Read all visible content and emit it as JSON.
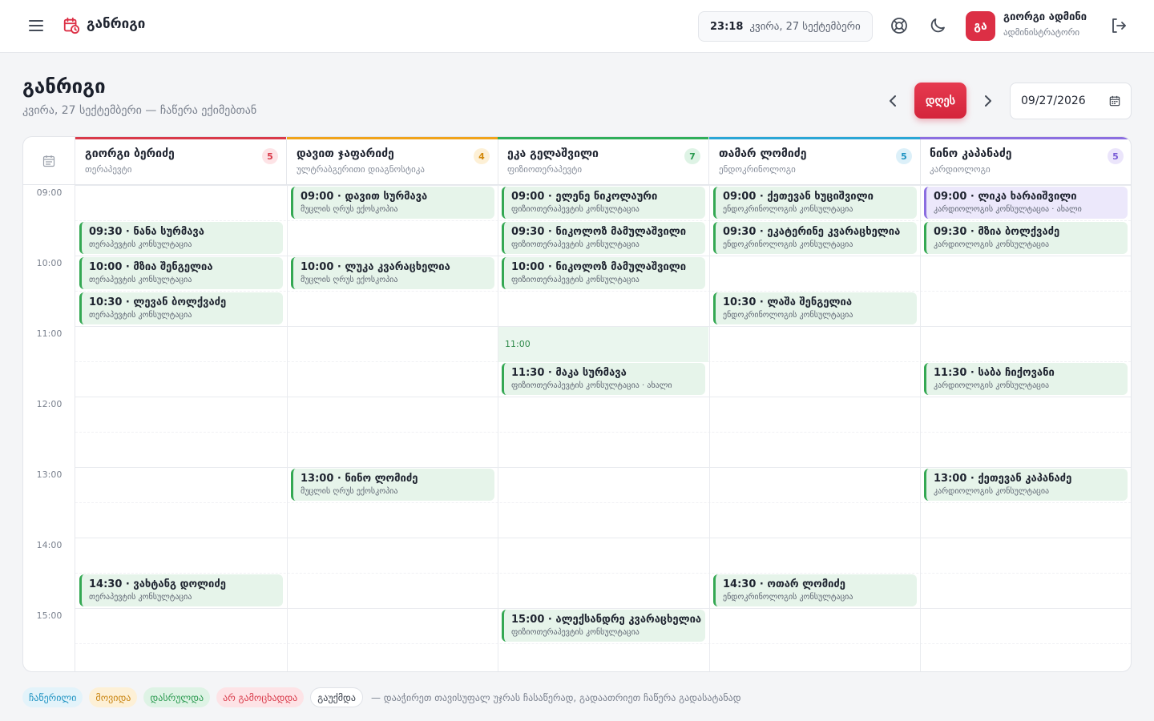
{
  "app": {
    "title": "განრიგი"
  },
  "topbar": {
    "time": "23:18",
    "date": "კვირა, 27 სექტემბერი",
    "user": {
      "initials": "გა",
      "name": "გიორგი ადმინი",
      "role": "ადმინისტრატორი"
    }
  },
  "page": {
    "title": "განრიგი",
    "subtitle": "კვირა, 27 სექტემბერი — ჩაწერა ექიმებთან",
    "day_button": "დღეს",
    "date_value": "09/27/2026"
  },
  "time_labels": [
    "09:00",
    "10:00",
    "11:00",
    "12:00",
    "13:00",
    "14:00",
    "15:00"
  ],
  "now_label": "11:00",
  "doctors": [
    {
      "name": "გიორგი ბერიძე",
      "role": "თერაპევტი",
      "count": "5",
      "color": "#d93a4a",
      "badge_bg": "#fde3e6",
      "badge_fg": "#d93a4a"
    },
    {
      "name": "დავით ჯაფარიძე",
      "role": "ულტრაბგერითი დიაგნოსტიკა",
      "count": "4",
      "color": "#f0a31b",
      "badge_bg": "#fdf0d6",
      "badge_fg": "#d38a0d"
    },
    {
      "name": "ეკა გელაშვილი",
      "role": "ფიზიოთერაპევტი",
      "count": "7",
      "color": "#2fae5a",
      "badge_bg": "#def3e5",
      "badge_fg": "#2b9a50"
    },
    {
      "name": "თამარ ლომიძე",
      "role": "ენდოკრინოლოგი",
      "count": "5",
      "color": "#2aa6d6",
      "badge_bg": "#dcf0f9",
      "badge_fg": "#1f93c2"
    },
    {
      "name": "ნინო კაპანაძე",
      "role": "კარდიოლოგი",
      "count": "5",
      "color": "#8b6ee0",
      "badge_bg": "#ebe5fb",
      "badge_fg": "#7a5cd6"
    }
  ],
  "appointments": [
    {
      "col": 0,
      "slot": 1,
      "title": "09:30 · ნანა სურმავა",
      "sub": "თერაპევტის კონსულტაცია",
      "kind": "done"
    },
    {
      "col": 0,
      "slot": 2,
      "title": "10:00 · მზია შენგელია",
      "sub": "თერაპევტის კონსულტაცია",
      "kind": "done"
    },
    {
      "col": 0,
      "slot": 3,
      "title": "10:30 · ლევან ბოლქვაძე",
      "sub": "თერაპევტის კონსულტაცია",
      "kind": "done"
    },
    {
      "col": 0,
      "slot": 11,
      "title": "14:30 · ვახტანგ დოლიძე",
      "sub": "თერაპევტის კონსულტაცია",
      "kind": "done"
    },
    {
      "col": 1,
      "slot": 0,
      "title": "09:00 · დავით სურმავა",
      "sub": "მუცლის ღრუს ექოსკოპია",
      "kind": "done"
    },
    {
      "col": 1,
      "slot": 2,
      "title": "10:00 · ლუკა კვარაცხელია",
      "sub": "მუცლის ღრუს ექოსკოპია",
      "kind": "done"
    },
    {
      "col": 1,
      "slot": 8,
      "title": "13:00 · ნინო ლომიძე",
      "sub": "მუცლის ღრუს ექოსკოპია",
      "kind": "done"
    },
    {
      "col": 2,
      "slot": 0,
      "title": "09:00 · ელენე ნიკოლაური",
      "sub": "ფიზიოთერაპევტის კონსულტაცია",
      "kind": "done"
    },
    {
      "col": 2,
      "slot": 1,
      "title": "09:30 · ნიკოლოზ მამულაშვილი",
      "sub": "ფიზიოთერაპევტის კონსულტაცია",
      "kind": "done"
    },
    {
      "col": 2,
      "slot": 2,
      "title": "10:00 · ნიკოლოზ მამულაშვილი",
      "sub": "ფიზიოთერაპევტის კონსულტაცია",
      "kind": "done"
    },
    {
      "col": 2,
      "slot": 5,
      "title": "11:30 · მაკა სურმავა",
      "sub": "ფიზიოთერაპევტის კონსულტაცია · ახალი",
      "kind": "done"
    },
    {
      "col": 2,
      "slot": 12,
      "title": "15:00 · ალექსანდრე კვარაცხელია",
      "sub": "ფიზიოთერაპევტის კონსულტაცია",
      "kind": "done"
    },
    {
      "col": 3,
      "slot": 0,
      "title": "09:00 · ქეთევან ხუციშვილი",
      "sub": "ენდოკრინოლოგის კონსულტაცია",
      "kind": "done"
    },
    {
      "col": 3,
      "slot": 1,
      "title": "09:30 · ეკატერინე კვარაცხელია",
      "sub": "ენდოკრინოლოგის კონსულტაცია",
      "kind": "done"
    },
    {
      "col": 3,
      "slot": 3,
      "title": "10:30 · ლაშა შენგელია",
      "sub": "ენდოკრინოლოგის კონსულტაცია",
      "kind": "done"
    },
    {
      "col": 3,
      "slot": 11,
      "title": "14:30 · ოთარ ლომიძე",
      "sub": "ენდოკრინოლოგის კონსულტაცია",
      "kind": "done"
    },
    {
      "col": 4,
      "slot": 0,
      "title": "09:00 · ლიკა ხარაიშვილი",
      "sub": "კარდიოლოგის კონსულტაცია · ახალი",
      "kind": "new"
    },
    {
      "col": 4,
      "slot": 1,
      "title": "09:30 · მზია ბოლქვაძე",
      "sub": "კარდიოლოგის კონსულტაცია",
      "kind": "done"
    },
    {
      "col": 4,
      "slot": 5,
      "title": "11:30 · საბა ჩიქოვანი",
      "sub": "კარდიოლოგის კონსულტაცია",
      "kind": "done"
    },
    {
      "col": 4,
      "slot": 8,
      "title": "13:00 · ქეთევან კაპანაძე",
      "sub": "კარდიოლოგის კონსულტაცია",
      "kind": "done"
    }
  ],
  "legend": {
    "items": [
      {
        "label": "ჩაწერილი",
        "bg": "#e3f3fa",
        "fg": "#1f93c2"
      },
      {
        "label": "მოვიდა",
        "bg": "#fdf0d6",
        "fg": "#c98410"
      },
      {
        "label": "დასრულდა",
        "bg": "#def3e5",
        "fg": "#2b9a50"
      },
      {
        "label": "არ გამოცხადდა",
        "bg": "#fde3e6",
        "fg": "#d93a4a"
      },
      {
        "label": "გაუქმდა",
        "bg": "#ffffff",
        "fg": "#3a404b"
      }
    ],
    "hint": "— დააჭირეთ თავისუფალ უჯრას ჩასაწერად, გადაათრიეთ ჩაწერა გადასატანად"
  }
}
